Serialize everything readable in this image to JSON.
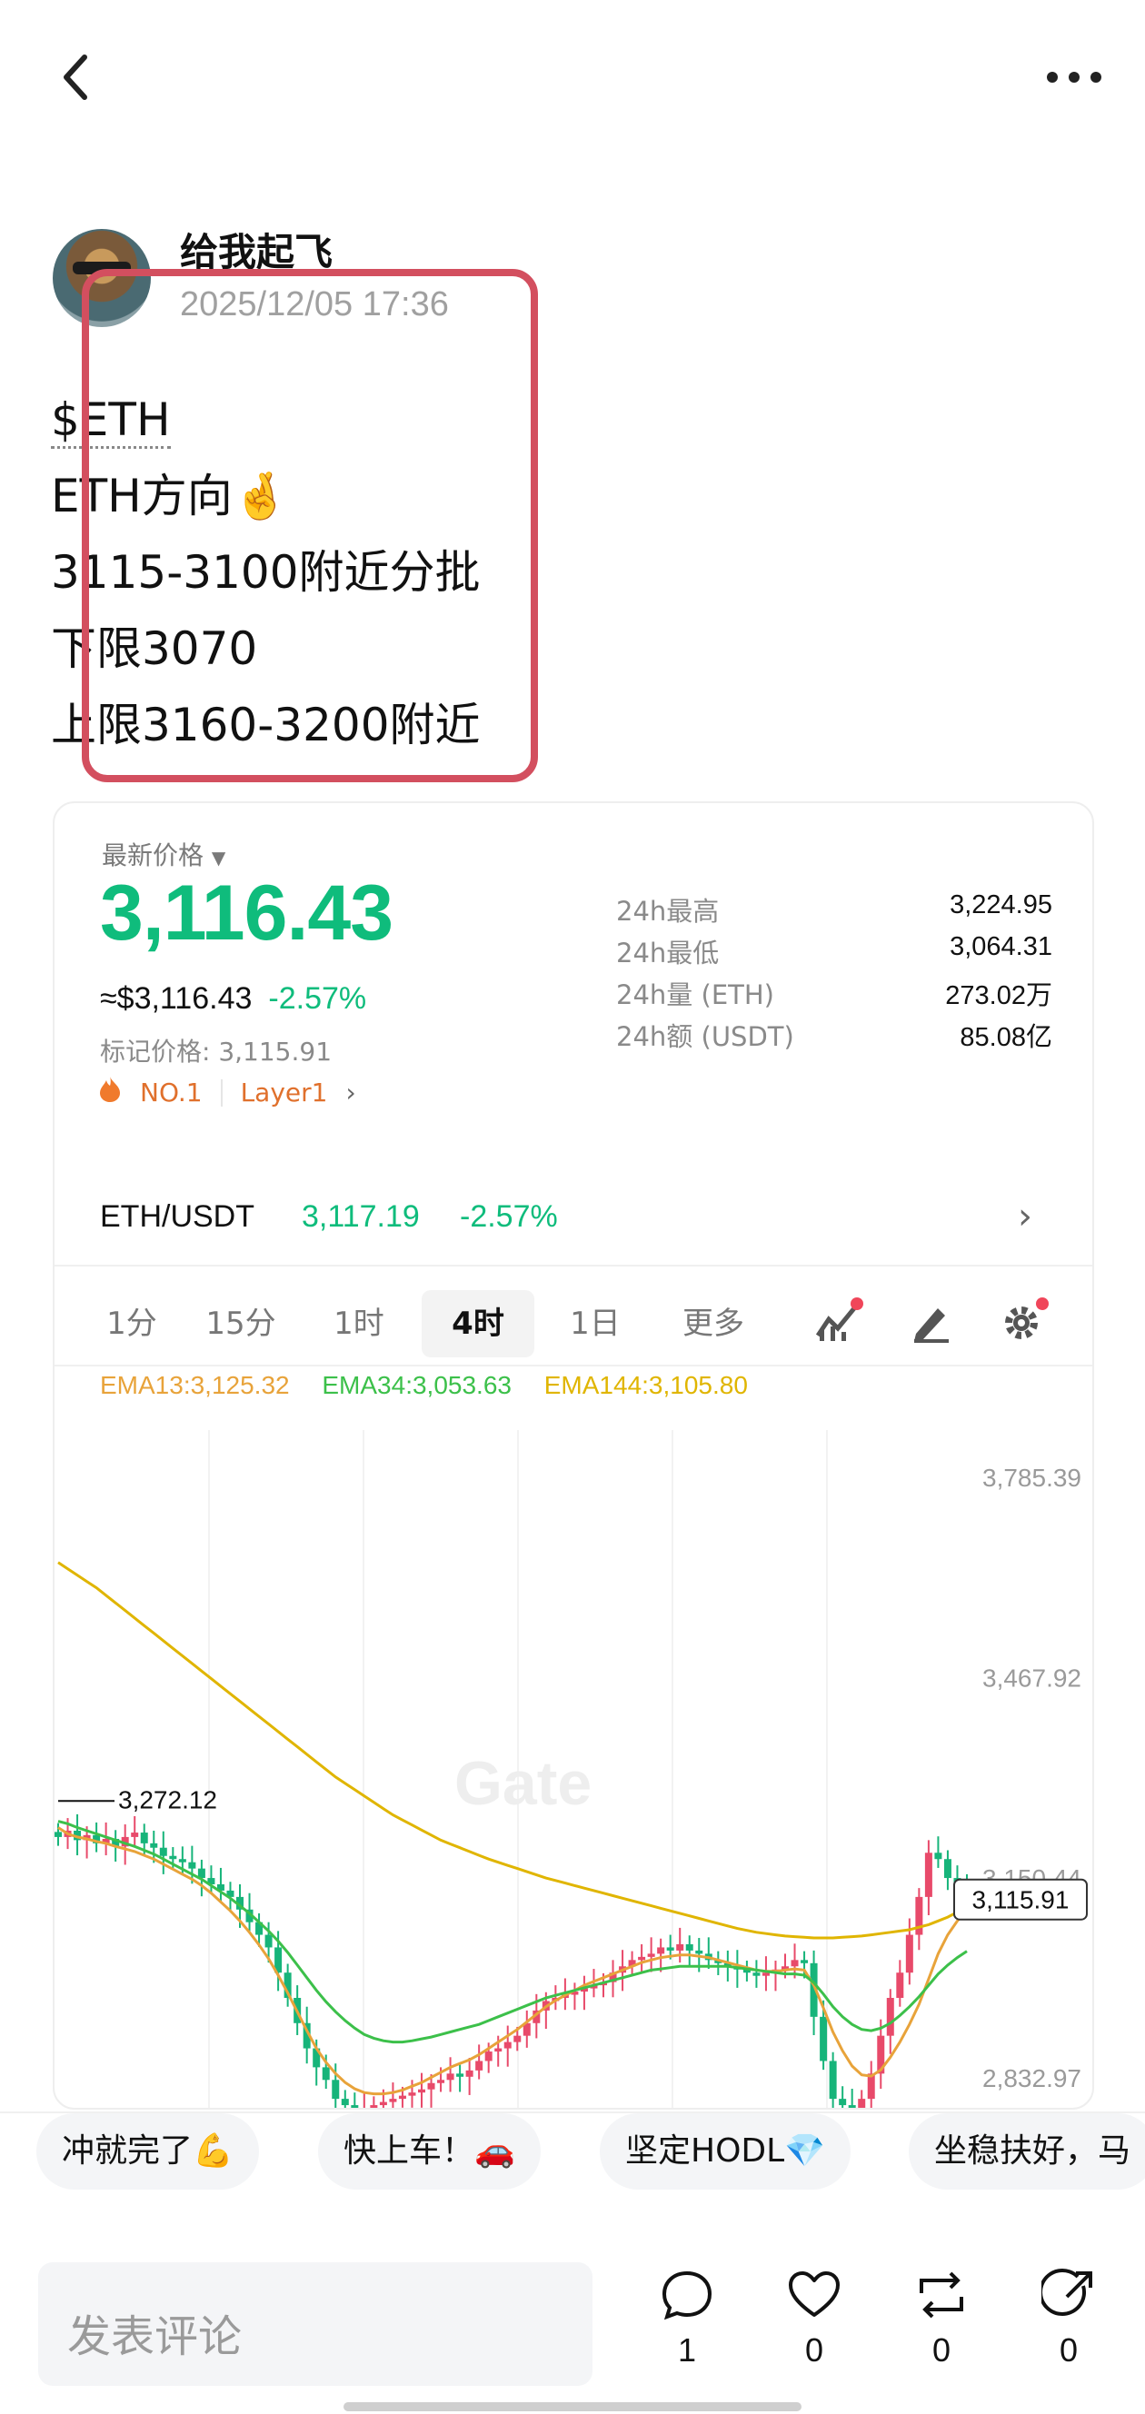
{
  "post": {
    "username": "给我起飞",
    "time": "2025/12/05 17:36",
    "ticker": "$ETH",
    "lines": [
      "ETH方向🤞",
      "3115-3100附近分批",
      "下限3070",
      "上限3160-3200附近"
    ]
  },
  "ticker_card": {
    "latest_label": "最新价格",
    "price": "3,116.43",
    "approx_usd": "≈$3,116.43",
    "change": "-2.57%",
    "mark_price": "标记价格: 3,115.91",
    "rank_tag": "NO.1",
    "category_tag": "Layer1",
    "stats": [
      {
        "label": "24h最高",
        "value": "3,224.95"
      },
      {
        "label": "24h最低",
        "value": "3,064.31"
      },
      {
        "label": "24h量 (ETH)",
        "value": "273.02万"
      },
      {
        "label": "24h额 (USDT)",
        "value": "85.08亿"
      }
    ],
    "pair": {
      "name": "ETH/USDT",
      "price": "3,117.19",
      "change": "-2.57%"
    },
    "timeframes": [
      "1分",
      "15分",
      "1时",
      "4时",
      "1日",
      "更多"
    ],
    "active_timeframe": "4时",
    "ema": [
      {
        "label": "EMA13:3,125.32",
        "color": "#e8a33a"
      },
      {
        "label": "EMA34:3,053.63",
        "color": "#3cc04a"
      },
      {
        "label": "EMA144:3,105.80",
        "color": "#e0b500"
      }
    ],
    "watermark": "Gate"
  },
  "chart_data": {
    "type": "line",
    "y_ticks": [
      "3,785.39",
      "3,467.92",
      "3,150.44",
      "2,832.97"
    ],
    "ylim": [
      2780,
      3860
    ],
    "high_marker": "3,272.12",
    "current_price_tag": "3,115.91",
    "x": [
      0,
      1,
      2,
      3,
      4,
      5,
      6,
      7,
      8,
      9,
      10,
      11,
      12,
      13,
      14,
      15,
      16,
      17,
      18,
      19,
      20,
      21,
      22,
      23,
      24,
      25,
      26,
      27,
      28,
      29,
      30,
      31,
      32,
      33,
      34,
      35,
      36,
      37,
      38,
      39,
      40,
      41,
      42,
      43,
      44,
      45,
      46,
      47,
      48,
      49,
      50,
      51,
      52,
      53,
      54,
      55,
      56,
      57,
      58,
      59,
      60,
      61,
      62,
      63,
      64,
      65,
      66,
      67,
      68,
      69,
      70,
      71,
      72,
      73,
      74,
      75,
      76,
      77,
      78,
      79,
      80,
      81,
      82,
      83,
      84,
      85,
      86,
      87,
      88,
      89,
      90,
      91,
      92,
      93,
      94,
      95
    ],
    "close": [
      3215,
      3225,
      3210,
      3218,
      3205,
      3212,
      3200,
      3215,
      3222,
      3205,
      3198,
      3185,
      3180,
      3175,
      3165,
      3150,
      3140,
      3130,
      3120,
      3100,
      3080,
      3060,
      3040,
      3000,
      2960,
      2920,
      2880,
      2850,
      2830,
      2800,
      2790,
      2780,
      2785,
      2790,
      2795,
      2800,
      2805,
      2810,
      2815,
      2825,
      2830,
      2840,
      2835,
      2845,
      2860,
      2875,
      2880,
      2890,
      2900,
      2920,
      2940,
      2955,
      2960,
      2965,
      2970,
      2975,
      2980,
      2985,
      3000,
      3010,
      3020,
      3025,
      3030,
      3040,
      3035,
      3045,
      3035,
      3030,
      3020,
      3015,
      3010,
      3005,
      3000,
      2995,
      3000,
      3005,
      3010,
      3020,
      3015,
      2930,
      2860,
      2800,
      2790,
      2785,
      2800,
      2840,
      2900,
      2960,
      3000,
      3060,
      3120,
      3190,
      3180,
      3150,
      3130,
      3115
    ],
    "series": [
      {
        "name": "EMA13",
        "values": [
          3230,
          3220,
          3215,
          3212,
          3208,
          3205,
          3200,
          3196,
          3192,
          3186,
          3180,
          3172,
          3164,
          3156,
          3148,
          3138,
          3126,
          3112,
          3098,
          3082,
          3064,
          3044,
          3022,
          2996,
          2968,
          2938,
          2908,
          2880,
          2858,
          2840,
          2826,
          2816,
          2810,
          2808,
          2808,
          2810,
          2814,
          2820,
          2826,
          2834,
          2842,
          2850,
          2856,
          2862,
          2870,
          2880,
          2890,
          2900,
          2910,
          2922,
          2934,
          2946,
          2956,
          2964,
          2972,
          2980,
          2986,
          2992,
          2998,
          3004,
          3010,
          3016,
          3020,
          3024,
          3026,
          3028,
          3028,
          3026,
          3024,
          3020,
          3016,
          3012,
          3008,
          3004,
          3002,
          3002,
          3004,
          3006,
          3004,
          2980,
          2944,
          2906,
          2876,
          2852,
          2838,
          2836,
          2846,
          2866,
          2890,
          2918,
          2950,
          2990,
          3030,
          3060,
          3082,
          3100
        ]
      },
      {
        "name": "EMA34",
        "values": [
          3240,
          3236,
          3230,
          3225,
          3220,
          3215,
          3210,
          3205,
          3200,
          3194,
          3188,
          3180,
          3172,
          3164,
          3156,
          3148,
          3138,
          3128,
          3118,
          3106,
          3094,
          3080,
          3066,
          3050,
          3032,
          3012,
          2992,
          2972,
          2954,
          2938,
          2924,
          2912,
          2902,
          2896,
          2892,
          2890,
          2890,
          2892,
          2895,
          2898,
          2902,
          2906,
          2910,
          2914,
          2918,
          2924,
          2930,
          2936,
          2942,
          2948,
          2954,
          2960,
          2964,
          2968,
          2972,
          2976,
          2980,
          2984,
          2988,
          2992,
          2996,
          3000,
          3004,
          3006,
          3008,
          3010,
          3010,
          3010,
          3010,
          3010,
          3010,
          3008,
          3006,
          3004,
          3002,
          3000,
          2998,
          2998,
          2996,
          2984,
          2966,
          2946,
          2930,
          2918,
          2910,
          2908,
          2912,
          2920,
          2932,
          2946,
          2962,
          2980,
          2998,
          3012,
          3024,
          3034
        ]
      },
      {
        "name": "EMA144",
        "values": [
          3650,
          3640,
          3630,
          3620,
          3610,
          3598,
          3586,
          3574,
          3562,
          3550,
          3538,
          3526,
          3514,
          3502,
          3490,
          3478,
          3466,
          3454,
          3442,
          3430,
          3418,
          3406,
          3394,
          3382,
          3370,
          3358,
          3346,
          3334,
          3322,
          3310,
          3300,
          3290,
          3280,
          3270,
          3260,
          3250,
          3242,
          3234,
          3226,
          3218,
          3210,
          3204,
          3198,
          3192,
          3186,
          3180,
          3175,
          3170,
          3165,
          3160,
          3155,
          3150,
          3146,
          3142,
          3138,
          3134,
          3130,
          3126,
          3122,
          3118,
          3114,
          3110,
          3106,
          3102,
          3098,
          3094,
          3090,
          3086,
          3082,
          3078,
          3074,
          3070,
          3067,
          3064,
          3062,
          3060,
          3058,
          3057,
          3056,
          3055,
          3055,
          3055,
          3056,
          3057,
          3058,
          3060,
          3062,
          3064,
          3066,
          3068,
          3072,
          3076,
          3082,
          3088,
          3096,
          3105
        ]
      }
    ]
  },
  "reactions": [
    "冲就完了💪",
    "快上车！🚗",
    "坚定HODL💎",
    "坐稳扶好，马"
  ],
  "comment": {
    "placeholder": "发表评论"
  },
  "actions": [
    {
      "name": "comment",
      "count": "1"
    },
    {
      "name": "like",
      "count": "0"
    },
    {
      "name": "repost",
      "count": "0"
    },
    {
      "name": "share",
      "count": "0"
    }
  ]
}
